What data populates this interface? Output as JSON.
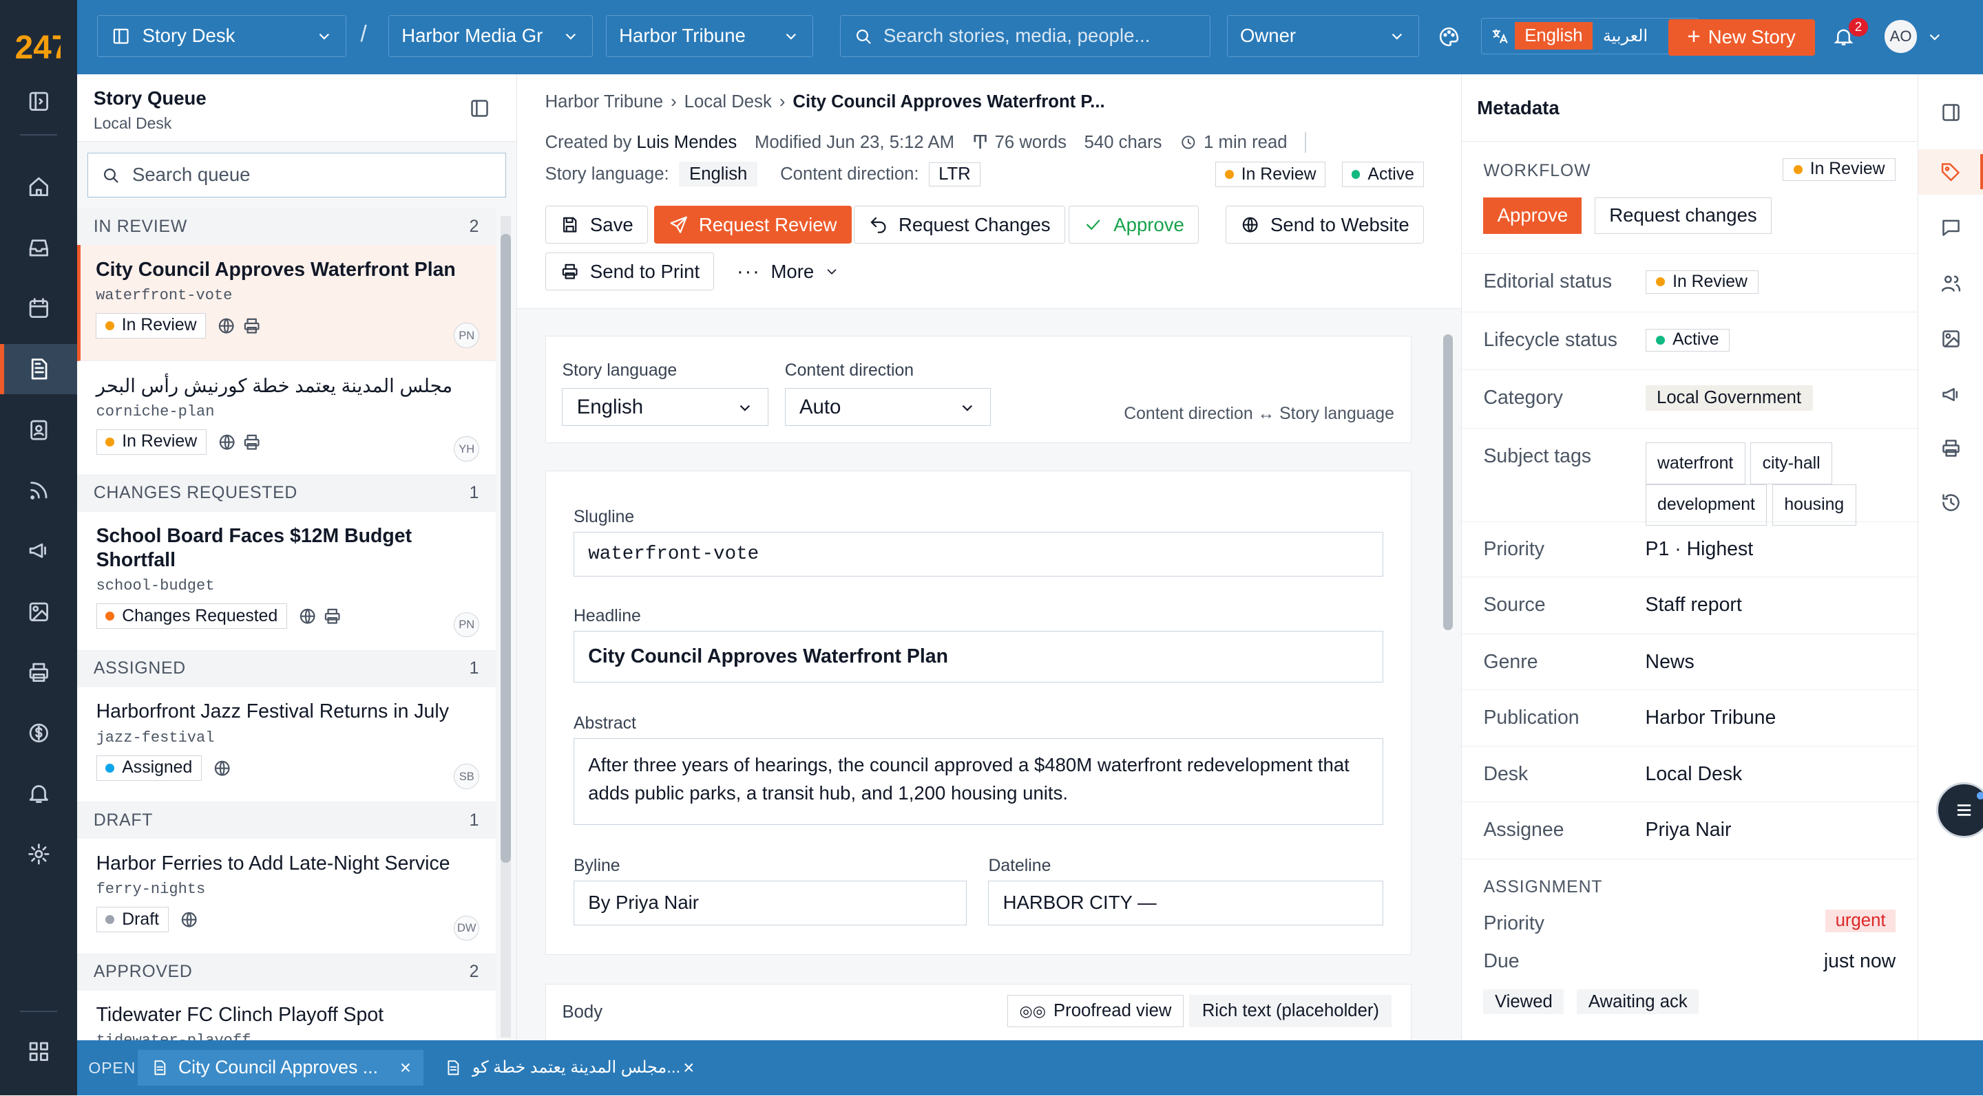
{
  "brand": {
    "logo_text": "247"
  },
  "topbar": {
    "workspace": "Story Desk",
    "separator": "/",
    "org": "Harbor Media Gr",
    "publication": "Harbor Tribune",
    "search_placeholder": "Search stories, media, people...",
    "role": "Owner",
    "lang_en": "English",
    "lang_ar": "العربية",
    "new_story": "New Story",
    "notifications": "2",
    "avatar": "AO"
  },
  "queue": {
    "title": "Story Queue",
    "subtitle": "Local Desk",
    "search_placeholder": "Search queue",
    "groups": [
      {
        "label": "IN REVIEW",
        "count": "2"
      },
      {
        "label": "CHANGES REQUESTED",
        "count": "1"
      },
      {
        "label": "ASSIGNED",
        "count": "1"
      },
      {
        "label": "DRAFT",
        "count": "1"
      },
      {
        "label": "APPROVED",
        "count": "2"
      }
    ],
    "cards": [
      {
        "title": "City Council Approves Waterfront Plan",
        "slug": "waterfront-vote",
        "status": "In Review",
        "status_color": "#f59e0b",
        "initials": "PN"
      },
      {
        "title": "مجلس المدينة يعتمد خطة كورنيش رأس البحر",
        "slug": "corniche-plan",
        "status": "In Review",
        "status_color": "#f59e0b",
        "initials": "YH"
      },
      {
        "title": "School Board Faces $12M Budget Shortfall",
        "slug": "school-budget",
        "status": "Changes Requested",
        "status_color": "#f97316",
        "initials": "PN"
      },
      {
        "title": "Harborfront Jazz Festival Returns in July",
        "slug": "jazz-festival",
        "status": "Assigned",
        "status_color": "#0ea5e9",
        "initials": "SB"
      },
      {
        "title": "Harbor Ferries to Add Late-Night Service",
        "slug": "ferry-nights",
        "status": "Draft",
        "status_color": "#9ca3af",
        "initials": "DW"
      },
      {
        "title": "Tidewater FC Clinch Playoff Spot",
        "slug": "tidewater-playoff"
      }
    ]
  },
  "editor": {
    "breadcrumb": [
      "Harbor Tribune",
      "Local Desk",
      "City Council Approves Waterfront P..."
    ],
    "created_by_label": "Created by",
    "created_by": "Luis Mendes",
    "modified": "Modified Jun 23, 5:12 AM",
    "words": "76 words",
    "chars": "540 chars",
    "read_time": "1 min read",
    "story_language_label": "Story language:",
    "story_language": "English",
    "content_direction_label": "Content direction:",
    "content_direction": "LTR",
    "status_review": "In Review",
    "status_active": "Active",
    "actions": {
      "save": "Save",
      "request_review": "Request Review",
      "request_changes": "Request Changes",
      "approve": "Approve",
      "send_website": "Send to Website",
      "send_print": "Send to Print",
      "more": "More"
    },
    "lang_box": {
      "story_language_label": "Story language",
      "story_language_value": "English",
      "content_direction_label": "Content direction",
      "content_direction_value": "Auto",
      "hint": "Content direction ↔ Story language"
    },
    "fields": {
      "slugline_label": "Slugline",
      "slugline": "waterfront-vote",
      "headline_label": "Headline",
      "headline": "City Council Approves Waterfront Plan",
      "abstract_label": "Abstract",
      "abstract": "After three years of hearings, the council approved a $480M waterfront redevelopment that adds public parks, a transit hub, and 1,200 housing units.",
      "byline_label": "Byline",
      "byline": "By Priya Nair",
      "dateline_label": "Dateline",
      "dateline": "HARBOR CITY —"
    },
    "body": {
      "label": "Body",
      "proofread": "Proofread view",
      "rich_text": "Rich text (placeholder)"
    }
  },
  "metadata": {
    "title": "Metadata",
    "workflow_label": "WORKFLOW",
    "workflow_status": "In Review",
    "approve": "Approve",
    "request_changes": "Request changes",
    "rows": {
      "editorial_status_k": "Editorial status",
      "editorial_status_v": "In Review",
      "lifecycle_status_k": "Lifecycle status",
      "lifecycle_status_v": "Active",
      "category_k": "Category",
      "category_v": "Local Government",
      "subject_tags_k": "Subject tags",
      "tags": [
        "waterfront",
        "city-hall",
        "development",
        "housing"
      ],
      "priority_k": "Priority",
      "priority_v": "P1 · Highest",
      "source_k": "Source",
      "source_v": "Staff report",
      "genre_k": "Genre",
      "genre_v": "News",
      "publication_k": "Publication",
      "publication_v": "Harbor Tribune",
      "desk_k": "Desk",
      "desk_v": "Local Desk",
      "assignee_k": "Assignee",
      "assignee_v": "Priya Nair"
    },
    "assignment": {
      "label": "ASSIGNMENT",
      "priority_k": "Priority",
      "priority_v": "urgent",
      "due_k": "Due",
      "due_v": "just now",
      "viewed": "Viewed",
      "awaiting": "Awaiting ack"
    }
  },
  "bottom": {
    "open_label": "OPEN",
    "tabs": [
      "City Council Approves ...",
      "...مجلس المدينة يعتمد خطة كورنيش رأس البحر"
    ]
  },
  "colors": {
    "accent": "#ee5b2b",
    "topbar": "#2a7ab8",
    "rail": "#1e2a38",
    "review": "#f59e0b",
    "active": "#10b981"
  }
}
